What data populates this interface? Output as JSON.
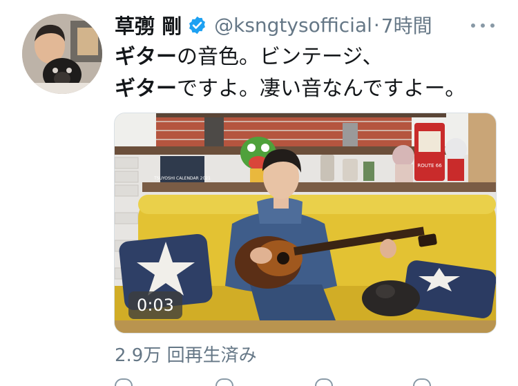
{
  "tweet": {
    "author_name": "草彅 剛",
    "handle": "@ksngtysofficial",
    "separator": "·",
    "time": "7時間",
    "text_line1_bold": "ギター",
    "text_line1_rest": "の音色。ビンテージ、",
    "text_line2_bold": "ギター",
    "text_line2_rest": "ですよ。凄い音なんですよー。"
  },
  "video": {
    "duration": "0:03",
    "views": "2.9万 回再生済み",
    "calendar_caption": "TSUYOSHI CALENDAR 2021",
    "sign_route": "ROUTE 66"
  },
  "colors": {
    "verified": "#1da1f2",
    "secondary_text": "#657786",
    "sofa": "#e8c633"
  },
  "icons": [
    "verified-badge-icon",
    "more-icon",
    "reply-icon",
    "retweet-icon",
    "like-icon",
    "share-icon"
  ]
}
